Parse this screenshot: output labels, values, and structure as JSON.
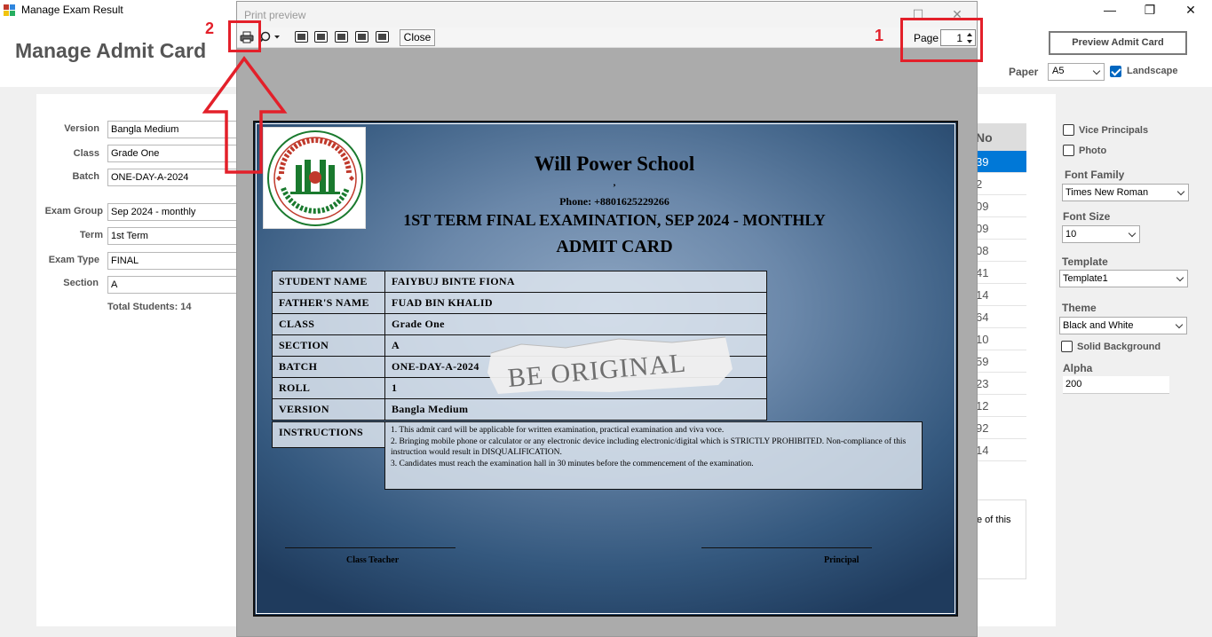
{
  "window": {
    "title": "Manage Exam Result",
    "minimize": "—",
    "restore": "❐",
    "close": "✕"
  },
  "header": {
    "title": "Manage Admit Card",
    "preview_button": "Preview Admit Card",
    "paper_label": "Paper",
    "paper_value": "A5",
    "landscape_label": "Landscape",
    "landscape_checked": true
  },
  "form": {
    "version_label": "Version",
    "version_value": "Bangla Medium",
    "class_label": "Class",
    "class_value": "Grade One",
    "batch_label": "Batch",
    "batch_value": "ONE-DAY-A-2024",
    "exam_group_label": "Exam Group",
    "exam_group_value": "Sep 2024 - monthly",
    "term_label": "Term",
    "term_value": "1st Term",
    "exam_type_label": "Exam Type",
    "exam_type_value": "FINAL",
    "section_label": "Section",
    "section_value": "A",
    "total_students": "Total Students: 14"
  },
  "list": {
    "header": "No",
    "rows": [
      "39",
      "2",
      "09",
      "09",
      "08",
      "41",
      "14",
      "64",
      "10",
      "59",
      "23",
      "12",
      "92",
      "14"
    ],
    "note": "e of this"
  },
  "options": {
    "vice_principals_label": "Vice Principals",
    "photo_label": "Photo",
    "font_family_label": "Font Family",
    "font_family_value": "Times New Roman",
    "font_size_label": "Font Size",
    "font_size_value": "10",
    "template_label": "Template",
    "template_value": "Template1",
    "theme_label": "Theme",
    "theme_value": "Black and White",
    "solid_background_label": "Solid Background",
    "alpha_label": "Alpha",
    "alpha_value": "200"
  },
  "print_preview": {
    "title": "Print preview",
    "close_button": "Close",
    "page_label": "Page",
    "page_value": "1"
  },
  "admit_card": {
    "school_name": "Will Power School",
    "comma": ",",
    "phone": "Phone: +8801625229266",
    "exam_title": "1ST TERM FINAL EXAMINATION, SEP 2024 - MONTHLY",
    "card_title": "ADMIT CARD",
    "rows": [
      {
        "key": "STUDENT NAME",
        "value": "FAIYBUJ BINTE FIONA"
      },
      {
        "key": "FATHER'S NAME",
        "value": "FUAD BIN KHALID"
      },
      {
        "key": "CLASS",
        "value": "Grade One"
      },
      {
        "key": "SECTION",
        "value": "A"
      },
      {
        "key": "BATCH",
        "value": "ONE-DAY-A-2024"
      },
      {
        "key": "ROLL",
        "value": "1"
      },
      {
        "key": "VERSION",
        "value": "Bangla Medium"
      }
    ],
    "instructions_label": "INSTRUCTIONS",
    "instructions": [
      "1. This admit card will be applicable for written examination, practical examination and viva voce.",
      "2. Bringing mobile phone or calculator or any electronic device including electronic/digital which is STRICTLY PROHIBITED. Non-compliance of this instruction would result in DISQUALIFICATION.",
      "3. Candidates must reach the examination hall in 30 minutes before the commencement of the examination."
    ],
    "watermark": "BE ORIGINAL",
    "signature_left": "Class Teacher",
    "signature_right": "Principal"
  },
  "annotations": {
    "marker_1": "1",
    "marker_2": "2",
    "color": "#e3202a"
  }
}
